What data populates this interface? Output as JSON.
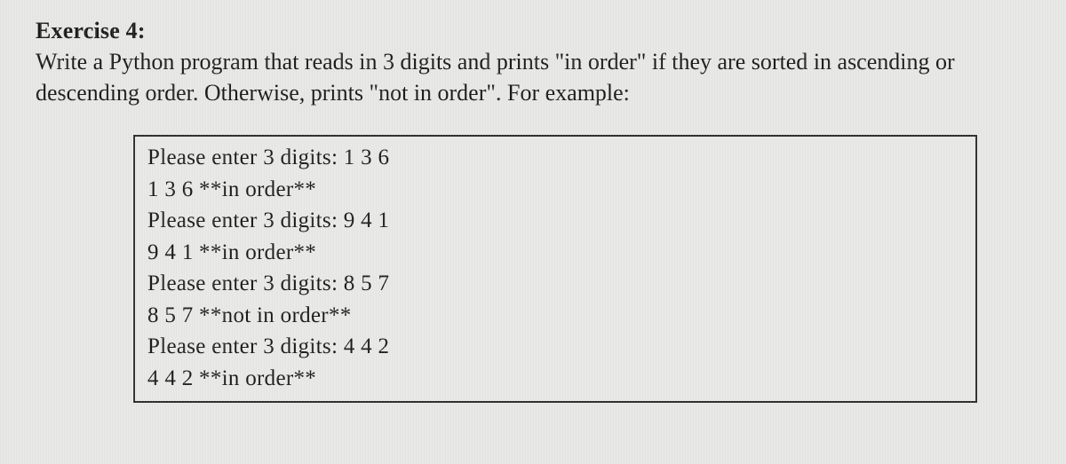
{
  "heading": "Exercise 4:",
  "instructions": "Write a Python program that reads in 3 digits and prints \"in order\" if they are sorted in ascending or descending order. Otherwise, prints \"not in order\". For example:",
  "example_lines": [
    "Please enter 3 digits: 1 3 6",
    "1 3 6 **in order**",
    "Please enter 3 digits: 9 4 1",
    "9 4 1 **in order**",
    "Please enter 3 digits: 8 5 7",
    "8 5 7 **not in order**",
    "Please enter 3 digits: 4 4 2",
    "4 4 2 **in order**"
  ]
}
